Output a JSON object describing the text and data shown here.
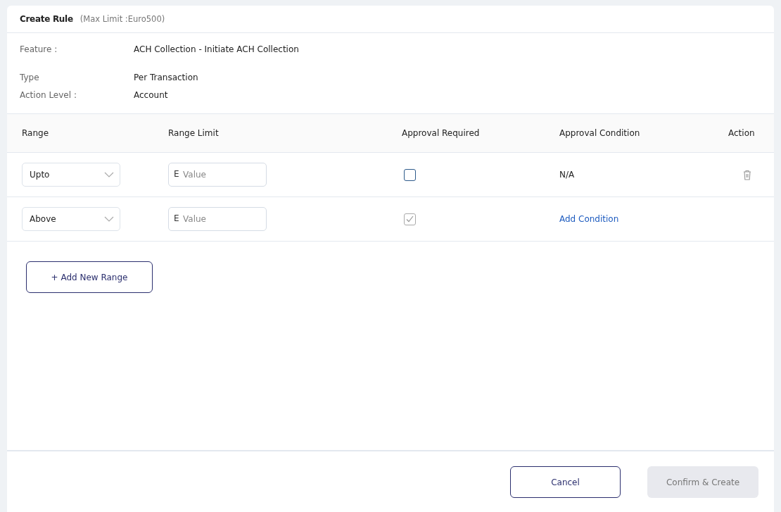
{
  "header": {
    "title": "Create Rule",
    "subtitle": "(Max Limit :Euro500)"
  },
  "details": [
    {
      "label": "Feature :",
      "value": "ACH Collection - Initiate ACH Collection"
    },
    {
      "label": "Type",
      "value": "Per Transaction"
    },
    {
      "label": "Action Level :",
      "value": "Account"
    }
  ],
  "table": {
    "columns": [
      "Range",
      "Range Limit",
      "Approval Required",
      "Approval Condition",
      "Action"
    ],
    "rows": [
      {
        "range": "Upto",
        "limit_prefix": "E",
        "limit_placeholder": "Value",
        "approval_required": {
          "checked": false,
          "disabled": false
        },
        "condition": {
          "kind": "text",
          "text": "N/A"
        },
        "deletable": true
      },
      {
        "range": "Above",
        "limit_prefix": "E",
        "limit_placeholder": "Value",
        "approval_required": {
          "checked": true,
          "disabled": true
        },
        "condition": {
          "kind": "link",
          "text": "Add Condition"
        },
        "deletable": false
      }
    ]
  },
  "add_button": "+ Add New Range",
  "footer": {
    "cancel": "Cancel",
    "confirm": {
      "label": "Confirm & Create",
      "disabled": true
    }
  }
}
